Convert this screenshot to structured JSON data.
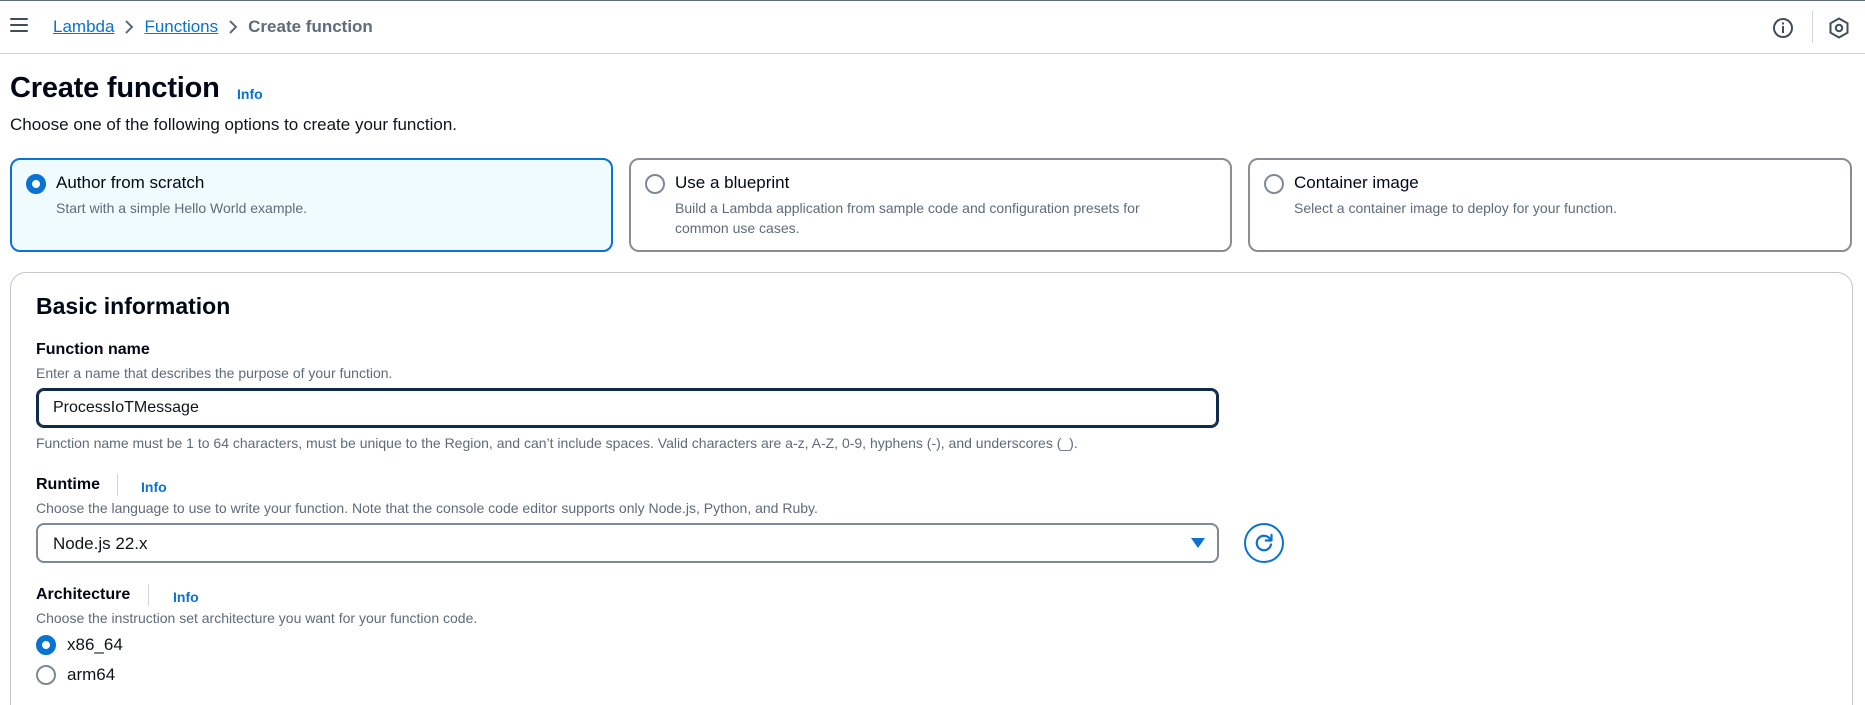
{
  "header": {
    "menu_icon": "hamburger-menu-icon",
    "breadcrumbs": [
      "Lambda",
      "Functions",
      "Create function"
    ],
    "info_icon": "info-circle-icon",
    "settings_icon": "gear-hexagon-icon"
  },
  "page": {
    "title": "Create function",
    "info_label": "Info",
    "description": "Choose one of the following options to create your function."
  },
  "options": [
    {
      "title": "Author from scratch",
      "description": "Start with a simple Hello World example.",
      "selected": true
    },
    {
      "title": "Use a blueprint",
      "description_line1": "Build a Lambda application from sample code and configuration presets for",
      "description_line2": "common use cases.",
      "selected": false
    },
    {
      "title": "Container image",
      "description": "Select a container image to deploy for your function.",
      "selected": false
    }
  ],
  "basic_info": {
    "title": "Basic information",
    "function_name": {
      "label": "Function name",
      "description": "Enter a name that describes the purpose of your function.",
      "value": "ProcessIoTMessage",
      "constraint": "Function name must be 1 to 64 characters, must be unique to the Region, and can’t include spaces. Valid characters are a-z, A-Z, 0-9, hyphens (-), and underscores (_)."
    },
    "runtime": {
      "label": "Runtime",
      "info_label": "Info",
      "description": "Choose the language to use to write your function. Note that the console code editor supports only Node.js, Python, and Ruby.",
      "value": "Node.js 22.x",
      "refresh_icon": "refresh-icon"
    },
    "architecture": {
      "label": "Architecture",
      "info_label": "Info",
      "description": "Choose the instruction set architecture you want for your function code.",
      "options": [
        {
          "label": "x86_64",
          "selected": true
        },
        {
          "label": "arm64",
          "selected": false
        }
      ]
    }
  },
  "colors": {
    "accent": "#0972d3",
    "selected_tile_bg": "#f0fbff",
    "text_primary": "#000716",
    "text_secondary": "#5f6b7a"
  }
}
